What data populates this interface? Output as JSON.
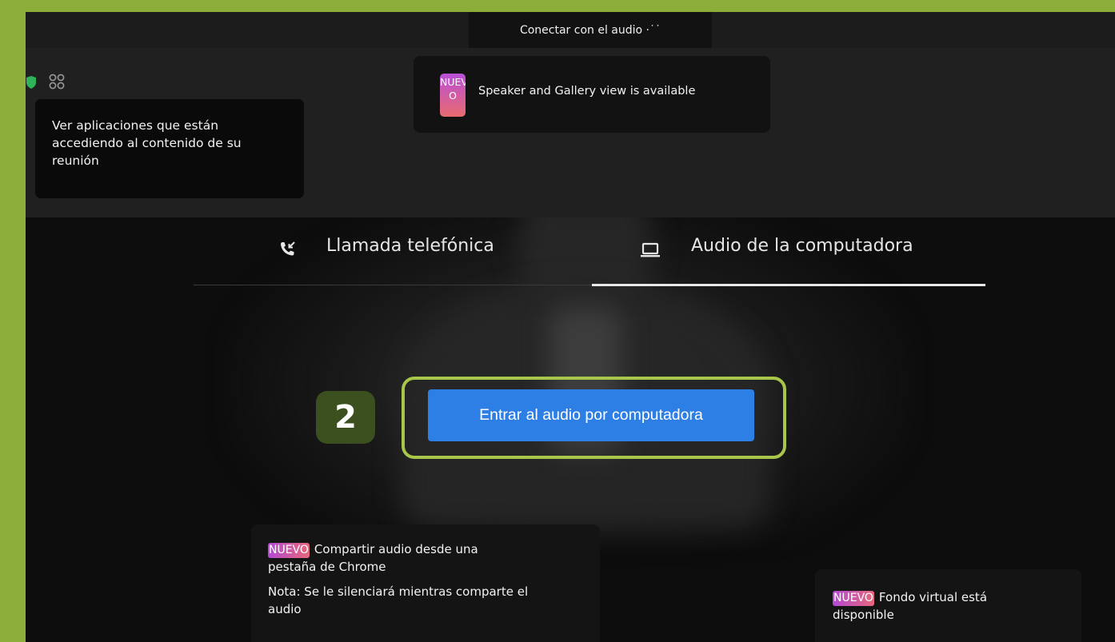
{
  "topbar": {
    "title": "Conectar con el audio ·˙˙"
  },
  "apps_tooltip": {
    "text_line1": "Ver aplicaciones que están",
    "text_line2": "accediendo al contenido de su",
    "text_line3": "reunión"
  },
  "speaker_tooltip": {
    "badge_line1": "NUEV",
    "badge_line2": "O",
    "text": "Speaker and Gallery view is available"
  },
  "tabs": [
    {
      "label": "Llamada telefónica",
      "icon": "phone-incoming-icon",
      "active": false
    },
    {
      "label": "Audio de la computadora",
      "icon": "laptop-icon",
      "active": true
    }
  ],
  "join": {
    "label": "Entrar al audio por computadora",
    "step": "2"
  },
  "tips": {
    "share": {
      "badge": "NUEVO",
      "title_line1": "Compartir audio desde una",
      "title_line2": "pestaña de Chrome",
      "note_line1": "Nota: Se le silenciará mientras comparte el",
      "note_line2": "audio"
    },
    "background": {
      "badge": "NUEVO",
      "text_line1": "Fondo virtual está",
      "text_line2": "disponible"
    }
  },
  "colors": {
    "frame": "#8cad38",
    "highlight": "#a8c64a",
    "button": "#2d7ee5",
    "step_badge": "#3c4f1e"
  }
}
